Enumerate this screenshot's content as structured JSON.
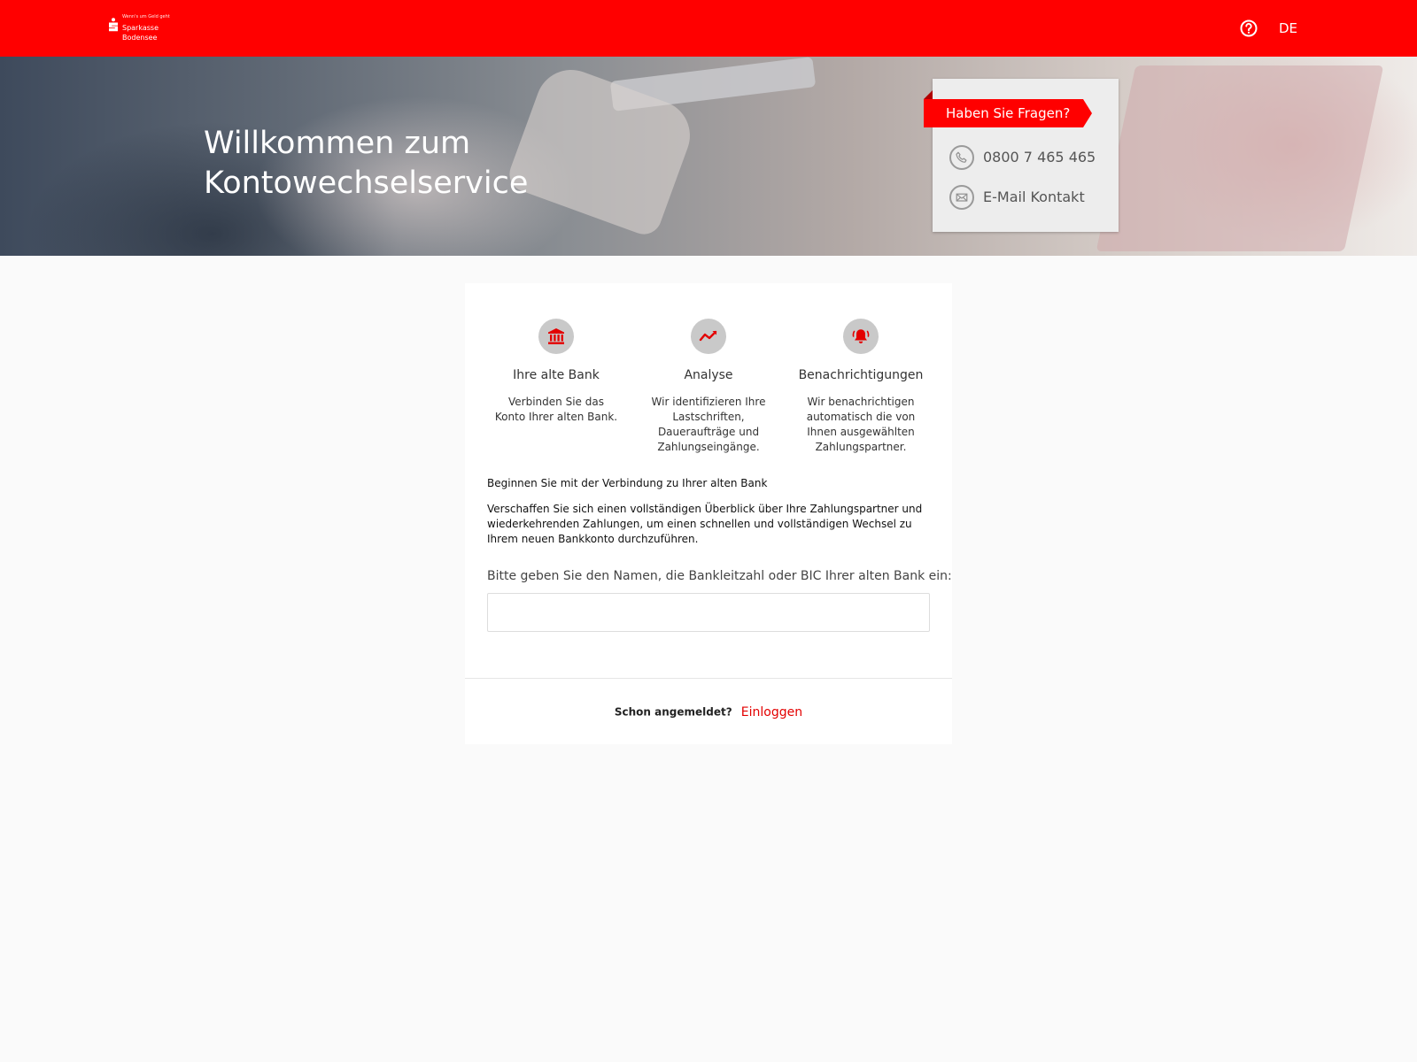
{
  "header": {
    "logo": {
      "tagline": "Wenn's um Geld geht",
      "name_line1": "Sparkasse",
      "name_line2": "Bodensee"
    },
    "help_icon": "question-circle-icon",
    "language": "DE"
  },
  "hero": {
    "title_line1": "Willkommen zum",
    "title_line2": "Kontowechselservice"
  },
  "contact_card": {
    "ribbon": "Haben Sie Fragen?",
    "phone": "0800 7 465 465",
    "email": "E-Mail Kontakt"
  },
  "features": [
    {
      "icon": "bank-icon",
      "title": "Ihre alte Bank",
      "description": "Verbinden Sie das Konto Ihrer alten Bank."
    },
    {
      "icon": "trend-chart-icon",
      "title": "Analyse",
      "description": "Wir identifizieren Ihre Lastschriften, Daueraufträge und Zahlungseingänge."
    },
    {
      "icon": "bell-alarm-icon",
      "title": "Benachrichtigungen",
      "description": "Wir benachrichtigen automatisch die von Ihnen ausgewählten Zahlungspartner."
    }
  ],
  "intro": {
    "heading": "Beginnen Sie mit der Verbindung zu Ihrer alten Bank",
    "text": "Verschaffen Sie sich einen vollständigen Überblick über Ihre Zahlungspartner und wiederkehrenden Zahlungen, um einen schnellen und vollständigen Wechsel zu Ihrem neuen Bankkonto durchzuführen."
  },
  "bank_search": {
    "label": "Bitte geben Sie den Namen, die Bankleitzahl oder BIC Ihrer alten Bank ein:",
    "value": "",
    "placeholder": ""
  },
  "login": {
    "question": "Schon angemeldet?",
    "link": "Einloggen"
  },
  "colors": {
    "brand_red": "#ff0000",
    "link_red": "#e30000",
    "icon_grey": "#c9c9c9",
    "background": "#fafafa"
  }
}
